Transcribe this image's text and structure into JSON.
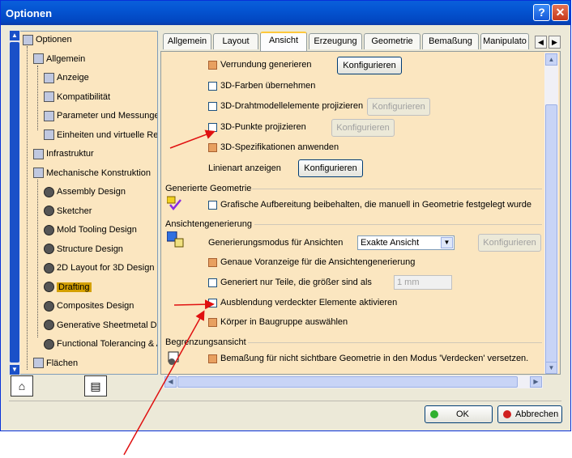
{
  "window": {
    "title": "Optionen",
    "help_label": "?",
    "close_label": "✕"
  },
  "tree": [
    {
      "label": "Optionen",
      "icon": "options-tree-icon"
    },
    {
      "label": "Allgemein",
      "icon": "general-icon"
    },
    {
      "label": "Anzeige",
      "icon": "display-icon"
    },
    {
      "label": "Kompatibilität",
      "icon": "compatibility-icon"
    },
    {
      "label": "Parameter und Messungen",
      "icon": "parameters-icon"
    },
    {
      "label": "Einheiten und virtuelle Realität",
      "icon": "units-icon"
    },
    {
      "label": "Infrastruktur",
      "icon": "infrastructure-icon"
    },
    {
      "label": "Mechanische Konstruktion",
      "icon": "mechanical-icon"
    },
    {
      "label": "Assembly Design",
      "icon": "gear-icon"
    },
    {
      "label": "Sketcher",
      "icon": "gear-icon"
    },
    {
      "label": "Mold Tooling Design",
      "icon": "gear-icon"
    },
    {
      "label": "Structure Design",
      "icon": "gear-icon"
    },
    {
      "label": "2D Layout for 3D Design",
      "icon": "gear-icon"
    },
    {
      "label": "Drafting",
      "icon": "gear-icon",
      "selected": true
    },
    {
      "label": "Composites Design",
      "icon": "gear-icon"
    },
    {
      "label": "Generative Sheetmetal Design",
      "icon": "gear-icon"
    },
    {
      "label": "Functional Tolerancing & Annotation",
      "icon": "gear-icon"
    },
    {
      "label": "Flächen",
      "icon": "surfaces-icon"
    }
  ],
  "tabs": [
    "Allgemein",
    "Layout",
    "Ansicht",
    "Erzeugung",
    "Geometrie",
    "Bemaßung",
    "Manipulato"
  ],
  "active_tab": "Ansicht",
  "options": {
    "verrundung": "Verrundung generieren",
    "farben": "3D-Farben übernehmen",
    "drahtmodell": "3D-Drahtmodellelemente projizieren",
    "punkte": "3D-Punkte projizieren",
    "spezifikationen": "3D-Spezifikationen anwenden",
    "linienart": "Linienart anzeigen",
    "grafisch": "Grafische Aufbereitung beibehalten, die manuell in Geometrie festgelegt wurde",
    "generierungsmodus": "Generierungsmodus für Ansichten",
    "exakte": "Exakte Ansicht",
    "genaue": "Genaue Voranzeige für die Ansichtengenerierung",
    "nur_teile": "Generiert nur Teile, die größer sind als",
    "mm_value": "1 mm",
    "ausblendung": "Ausblendung verdeckter Elemente aktivieren",
    "koerper": "Körper in Baugruppe auswählen",
    "bemassung": "Bemaßung für nicht sichtbare Geometrie in den Modus 'Verdecken' versetzen."
  },
  "sections": {
    "generierte_geometrie": "Generierte Geometrie",
    "ansichtengenerierung": "Ansichtengenerierung",
    "begrenzungsansicht": "Begrenzungsansicht"
  },
  "konfigurieren": "Konfigurieren",
  "footer": {
    "ok": "OK",
    "cancel": "Abbrechen"
  },
  "colors": {
    "panel_bg": "#fbe6c0",
    "title_blue": "#0454d1",
    "annotation_red": "#e01010",
    "checked_orange": "#e8a060"
  }
}
